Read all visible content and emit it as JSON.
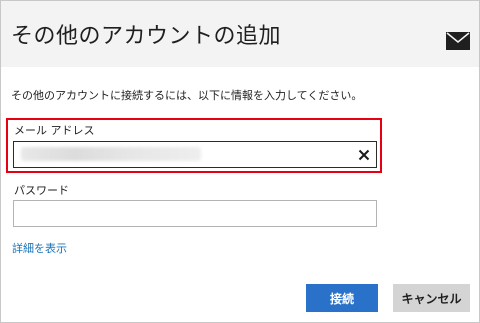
{
  "dialog": {
    "title": "その他のアカウントの追加",
    "header_icon": "mail-icon"
  },
  "form": {
    "instruction": "その他のアカウントに接続するには、以下に情報を入力してください。",
    "email": {
      "label": "メール アドレス",
      "value": "",
      "clear_icon": "close-icon"
    },
    "password": {
      "label": "パスワード",
      "value": ""
    },
    "details_link": "詳細を表示"
  },
  "buttons": {
    "connect": "接続",
    "cancel": "キャンセル"
  },
  "colors": {
    "highlight": "#e60012",
    "primary_button": "#2a72c9",
    "link": "#1a73b8",
    "header_bg": "#f3f3f3"
  }
}
